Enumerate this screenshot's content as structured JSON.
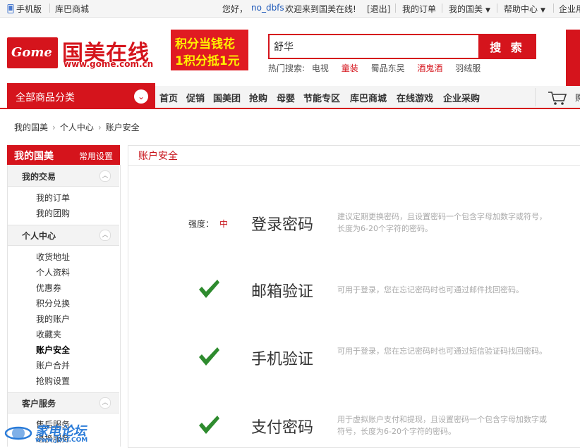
{
  "topbar": {
    "mobile": "手机版",
    "koobee": "库巴商城",
    "hello": "您好，",
    "username": "no_dbfs",
    "welcome": "欢迎来到国美在线!",
    "logout": "[退出]",
    "my_orders": "我的订单",
    "my_gome": "我的国美",
    "help": "帮助中心",
    "enterprise": "企业用"
  },
  "header": {
    "logo_en": "Gome",
    "logo_cn": "国美在线",
    "logo_url": "www.gome.com.cn",
    "promo_line1": "积分当钱花",
    "promo_line2": "1积分抵1元",
    "search_value": "舒华",
    "search_button": "搜 索",
    "hot_label": "热门搜索:",
    "hot_terms": [
      "电视",
      "童装",
      "蜀品东吴",
      "酒鬼酒",
      "羽绒服"
    ],
    "right_banner": "¥"
  },
  "nav": {
    "all_categories": "全部商品分类",
    "items": [
      "首页",
      "促销",
      "国美团",
      "抢购",
      "母婴",
      "节能专区",
      "库巴商城",
      "在线游戏",
      "企业采购"
    ],
    "cart_text": "购"
  },
  "breadcrumb": [
    "我的国美",
    "个人中心",
    "账户安全"
  ],
  "sidebar": {
    "title": "我的国美",
    "settings": "常用设置",
    "sections": [
      {
        "title": "我的交易",
        "items": [
          "我的订单",
          "我的团购"
        ]
      },
      {
        "title": "个人中心",
        "items": [
          "收货地址",
          "个人资料",
          "优惠券",
          "积分兑换",
          "我的账户",
          "收藏夹",
          "账户安全",
          "账户合并",
          "抢购设置"
        ]
      },
      {
        "title": "客户服务",
        "items": [
          "售后服务",
          "退换服务"
        ]
      }
    ]
  },
  "main": {
    "title": "账户安全",
    "strength_label": "强度：",
    "strength_value": "中",
    "items": [
      {
        "title": "登录密码",
        "desc": "建议定期更换密码，且设置密码一个包含字母加数字或符号，长度为6-20个字符的密码。"
      },
      {
        "title": "邮箱验证",
        "desc": "可用于登录，您在忘记密码时也可通过邮件找回密码。"
      },
      {
        "title": "手机验证",
        "desc": "可用于登录，您在忘记密码时也可通过短信验证码找回密码。"
      },
      {
        "title": "支付密码",
        "desc": "用于虚拟账户支付和提现，且设置密码一个包含字母加数字或符号，长度为6-20个字符的密码。"
      }
    ]
  },
  "watermark": {
    "text": "家电论坛",
    "url": "www.JDLT.COM"
  },
  "colors": {
    "brand_red": "#d5141c",
    "check_green": "#2e8b2e",
    "watermark_blue": "#2a7bd8"
  }
}
